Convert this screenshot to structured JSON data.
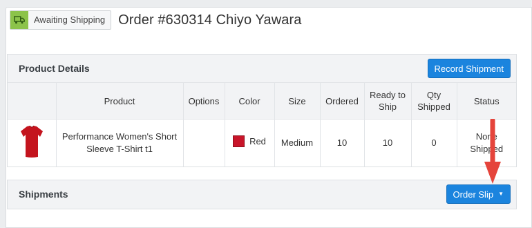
{
  "order": {
    "status_label": "Awaiting Shipping",
    "title": "Order #630314 Chiyo Yawara"
  },
  "product_details": {
    "title": "Product Details",
    "record_button": "Record Shipment",
    "columns": [
      "",
      "Product",
      "Options",
      "Color",
      "Size",
      "Ordered",
      "Ready to Ship",
      "Qty Shipped",
      "Status"
    ],
    "rows": [
      {
        "thumbnail": "red-tshirt-thumbnail",
        "product": "Performance Women's Short Sleeve T-Shirt t1",
        "options": "",
        "color": "Red",
        "color_hex": "#c8152a",
        "size": "Medium",
        "ordered": "10",
        "ready_to_ship": "10",
        "qty_shipped": "0",
        "status": "None Shipped"
      }
    ]
  },
  "shipments": {
    "title": "Shipments",
    "order_slip_button": "Order Slip"
  },
  "colors": {
    "accent": "#1b84de",
    "status_green": "#8cc34a",
    "arrow": "#e5443b"
  }
}
